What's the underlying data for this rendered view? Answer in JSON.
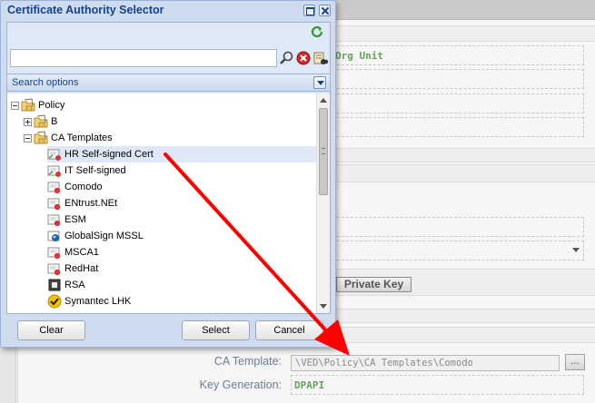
{
  "dialog": {
    "title": "Certificate Authority Selector",
    "search": {
      "value": "",
      "placeholder": ""
    },
    "search_options_label": "Search options",
    "buttons": {
      "clear": "Clear",
      "select": "Select",
      "cancel": "Cancel"
    }
  },
  "tree": [
    {
      "label": "Policy",
      "icon": "folder-icon",
      "expander": "minus",
      "depth": 0
    },
    {
      "label": "B",
      "icon": "folder-icon",
      "expander": "plus",
      "depth": 1
    },
    {
      "label": "CA Templates",
      "icon": "folder-icon",
      "expander": "minus",
      "depth": 1
    },
    {
      "label": "HR Self-signed Cert",
      "icon": "self-signed-cert-icon",
      "selected": true,
      "depth": 2
    },
    {
      "label": "IT Self-signed",
      "icon": "self-signed-cert-icon",
      "depth": 2
    },
    {
      "label": "Comodo",
      "icon": "ca-cert-icon",
      "depth": 2
    },
    {
      "label": "ENtrust.NEt",
      "icon": "ca-cert-icon",
      "depth": 2
    },
    {
      "label": "ESM",
      "icon": "ca-cert-icon",
      "depth": 2
    },
    {
      "label": "GlobalSign MSSL",
      "icon": "globalsign-icon",
      "depth": 2
    },
    {
      "label": "MSCA1",
      "icon": "ca-cert-icon",
      "depth": 2
    },
    {
      "label": "RedHat",
      "icon": "ca-cert-icon",
      "depth": 2
    },
    {
      "label": "RSA",
      "icon": "rsa-icon",
      "depth": 2
    },
    {
      "label": "Symantec LHK",
      "icon": "symantec-icon",
      "depth": 2
    }
  ],
  "background": {
    "org_unit_label": "Org Unit",
    "private_key_button": "Private Key",
    "ca_template_label": "CA Template:",
    "ca_template_value": "\\VED\\Policy\\CA Templates\\Comodo",
    "browse_button": "...",
    "key_generation_label": "Key Generation:",
    "key_generation_value": "DPAPI"
  },
  "colors": {
    "dialog_title": "#15428b",
    "green_text": "#62a35b",
    "label_text": "#6b7b9a",
    "arrow": "#ff0000"
  }
}
